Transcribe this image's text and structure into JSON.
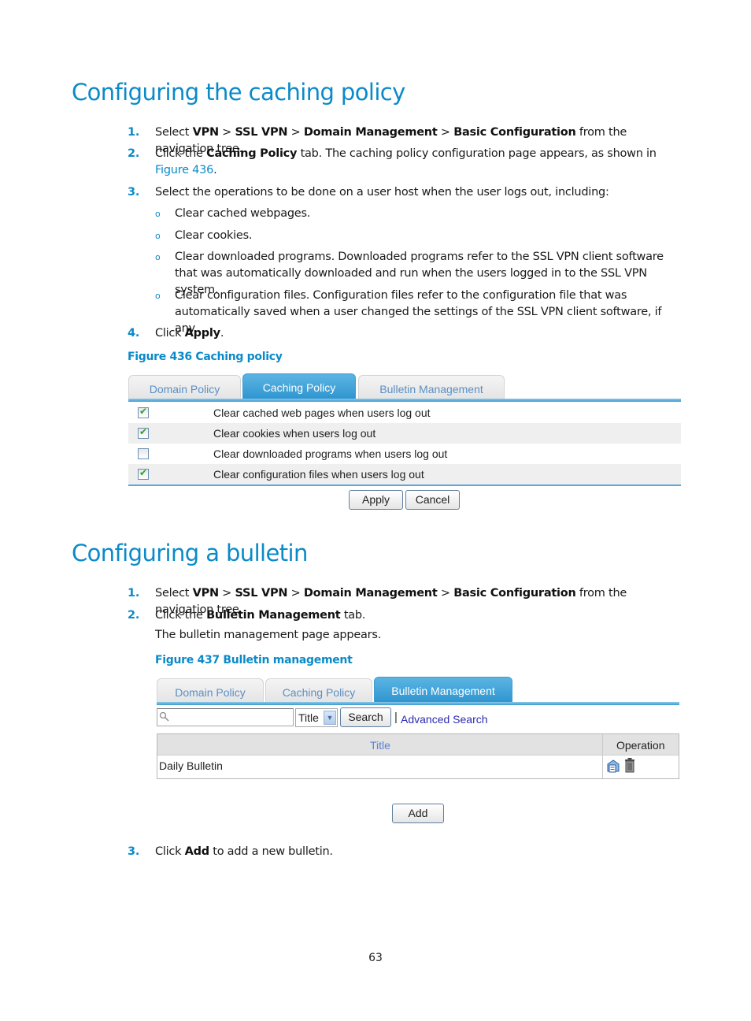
{
  "section1": {
    "heading": "Configuring the caching policy",
    "steps": [
      {
        "num": "1.",
        "parts": [
          {
            "t": "Select "
          },
          {
            "b": "VPN"
          },
          {
            "t": " > "
          },
          {
            "b": "SSL VPN"
          },
          {
            "t": " > "
          },
          {
            "b": "Domain Management"
          },
          {
            "t": " > "
          },
          {
            "b": "Basic Configuration"
          },
          {
            "t": " from the navigation tree."
          }
        ]
      },
      {
        "num": "2.",
        "parts": [
          {
            "t": "Click the "
          },
          {
            "b": "Caching Policy"
          },
          {
            "t": " tab. The caching policy configuration page appears, as shown in "
          },
          {
            "link": "Figure 436"
          },
          {
            "t": "."
          }
        ]
      },
      {
        "num": "3.",
        "parts": [
          {
            "t": "Select the operations to be done on a user host when the user logs out, including:"
          }
        ]
      },
      {
        "num": "4.",
        "parts": [
          {
            "t": "Click "
          },
          {
            "b": "Apply"
          },
          {
            "t": "."
          }
        ]
      }
    ],
    "bullets": [
      "Clear cached webpages.",
      "Clear cookies.",
      "Clear downloaded programs. Downloaded programs refer to the SSL VPN client software that was automatically downloaded and run when the users logged in to the SSL VPN system.",
      "Clear configuration files. Configuration files refer to the configuration file that was automatically saved when a user changed the settings of the SSL VPN client software, if any."
    ],
    "bullet_glyph": "o",
    "figure_caption": "Figure 436 Caching policy",
    "figure": {
      "tabs": [
        "Domain Policy",
        "Caching Policy",
        "Bulletin Management"
      ],
      "active_tab": "Caching Policy",
      "options": [
        {
          "label": "Clear cached web pages when users log out",
          "checked": true
        },
        {
          "label": "Clear cookies when users log out",
          "checked": true
        },
        {
          "label": "Clear downloaded programs when users log out",
          "checked": false
        },
        {
          "label": "Clear configuration files when users log out",
          "checked": true
        }
      ],
      "apply_label": "Apply",
      "cancel_label": "Cancel"
    }
  },
  "section2": {
    "heading": "Configuring a bulletin",
    "steps": [
      {
        "num": "1.",
        "parts": [
          {
            "t": "Select "
          },
          {
            "b": "VPN"
          },
          {
            "t": " > "
          },
          {
            "b": "SSL VPN"
          },
          {
            "t": " > "
          },
          {
            "b": "Domain Management"
          },
          {
            "t": " > "
          },
          {
            "b": "Basic Configuration"
          },
          {
            "t": " from the navigation tree."
          }
        ]
      },
      {
        "num": "2.",
        "parts": [
          {
            "t": "Click the "
          },
          {
            "b": "Bulletin Management"
          },
          {
            "t": " tab."
          }
        ]
      },
      {
        "num": "3.",
        "parts": [
          {
            "t": "Click "
          },
          {
            "b": "Add"
          },
          {
            "t": " to add a new bulletin."
          }
        ]
      }
    ],
    "note": "The bulletin management page appears.",
    "figure_caption": "Figure 437 Bulletin management",
    "figure": {
      "tabs": [
        "Domain Policy",
        "Caching Policy",
        "Bulletin Management"
      ],
      "active_tab": "Bulletin Management",
      "search": {
        "value": "",
        "placeholder": "",
        "icon": "search-icon"
      },
      "filter_selected": "Title",
      "search_label": "Search",
      "separator": "|",
      "advanced_search_label": "Advanced Search",
      "columns": [
        "Title",
        "Operation"
      ],
      "rows": [
        {
          "title": "Daily Bulletin",
          "operations": [
            "edit-icon",
            "delete-icon"
          ]
        }
      ],
      "add_label": "Add"
    }
  },
  "page_number": "63",
  "colors": {
    "accent": "#0a8ac9",
    "tab_active": "#2e95cf",
    "tab_inactive_text": "#5b8fc4",
    "checkbox_check": "#2ea02e",
    "link_text": "#2b2bb0",
    "grid_header_title": "#5b7fd0"
  }
}
